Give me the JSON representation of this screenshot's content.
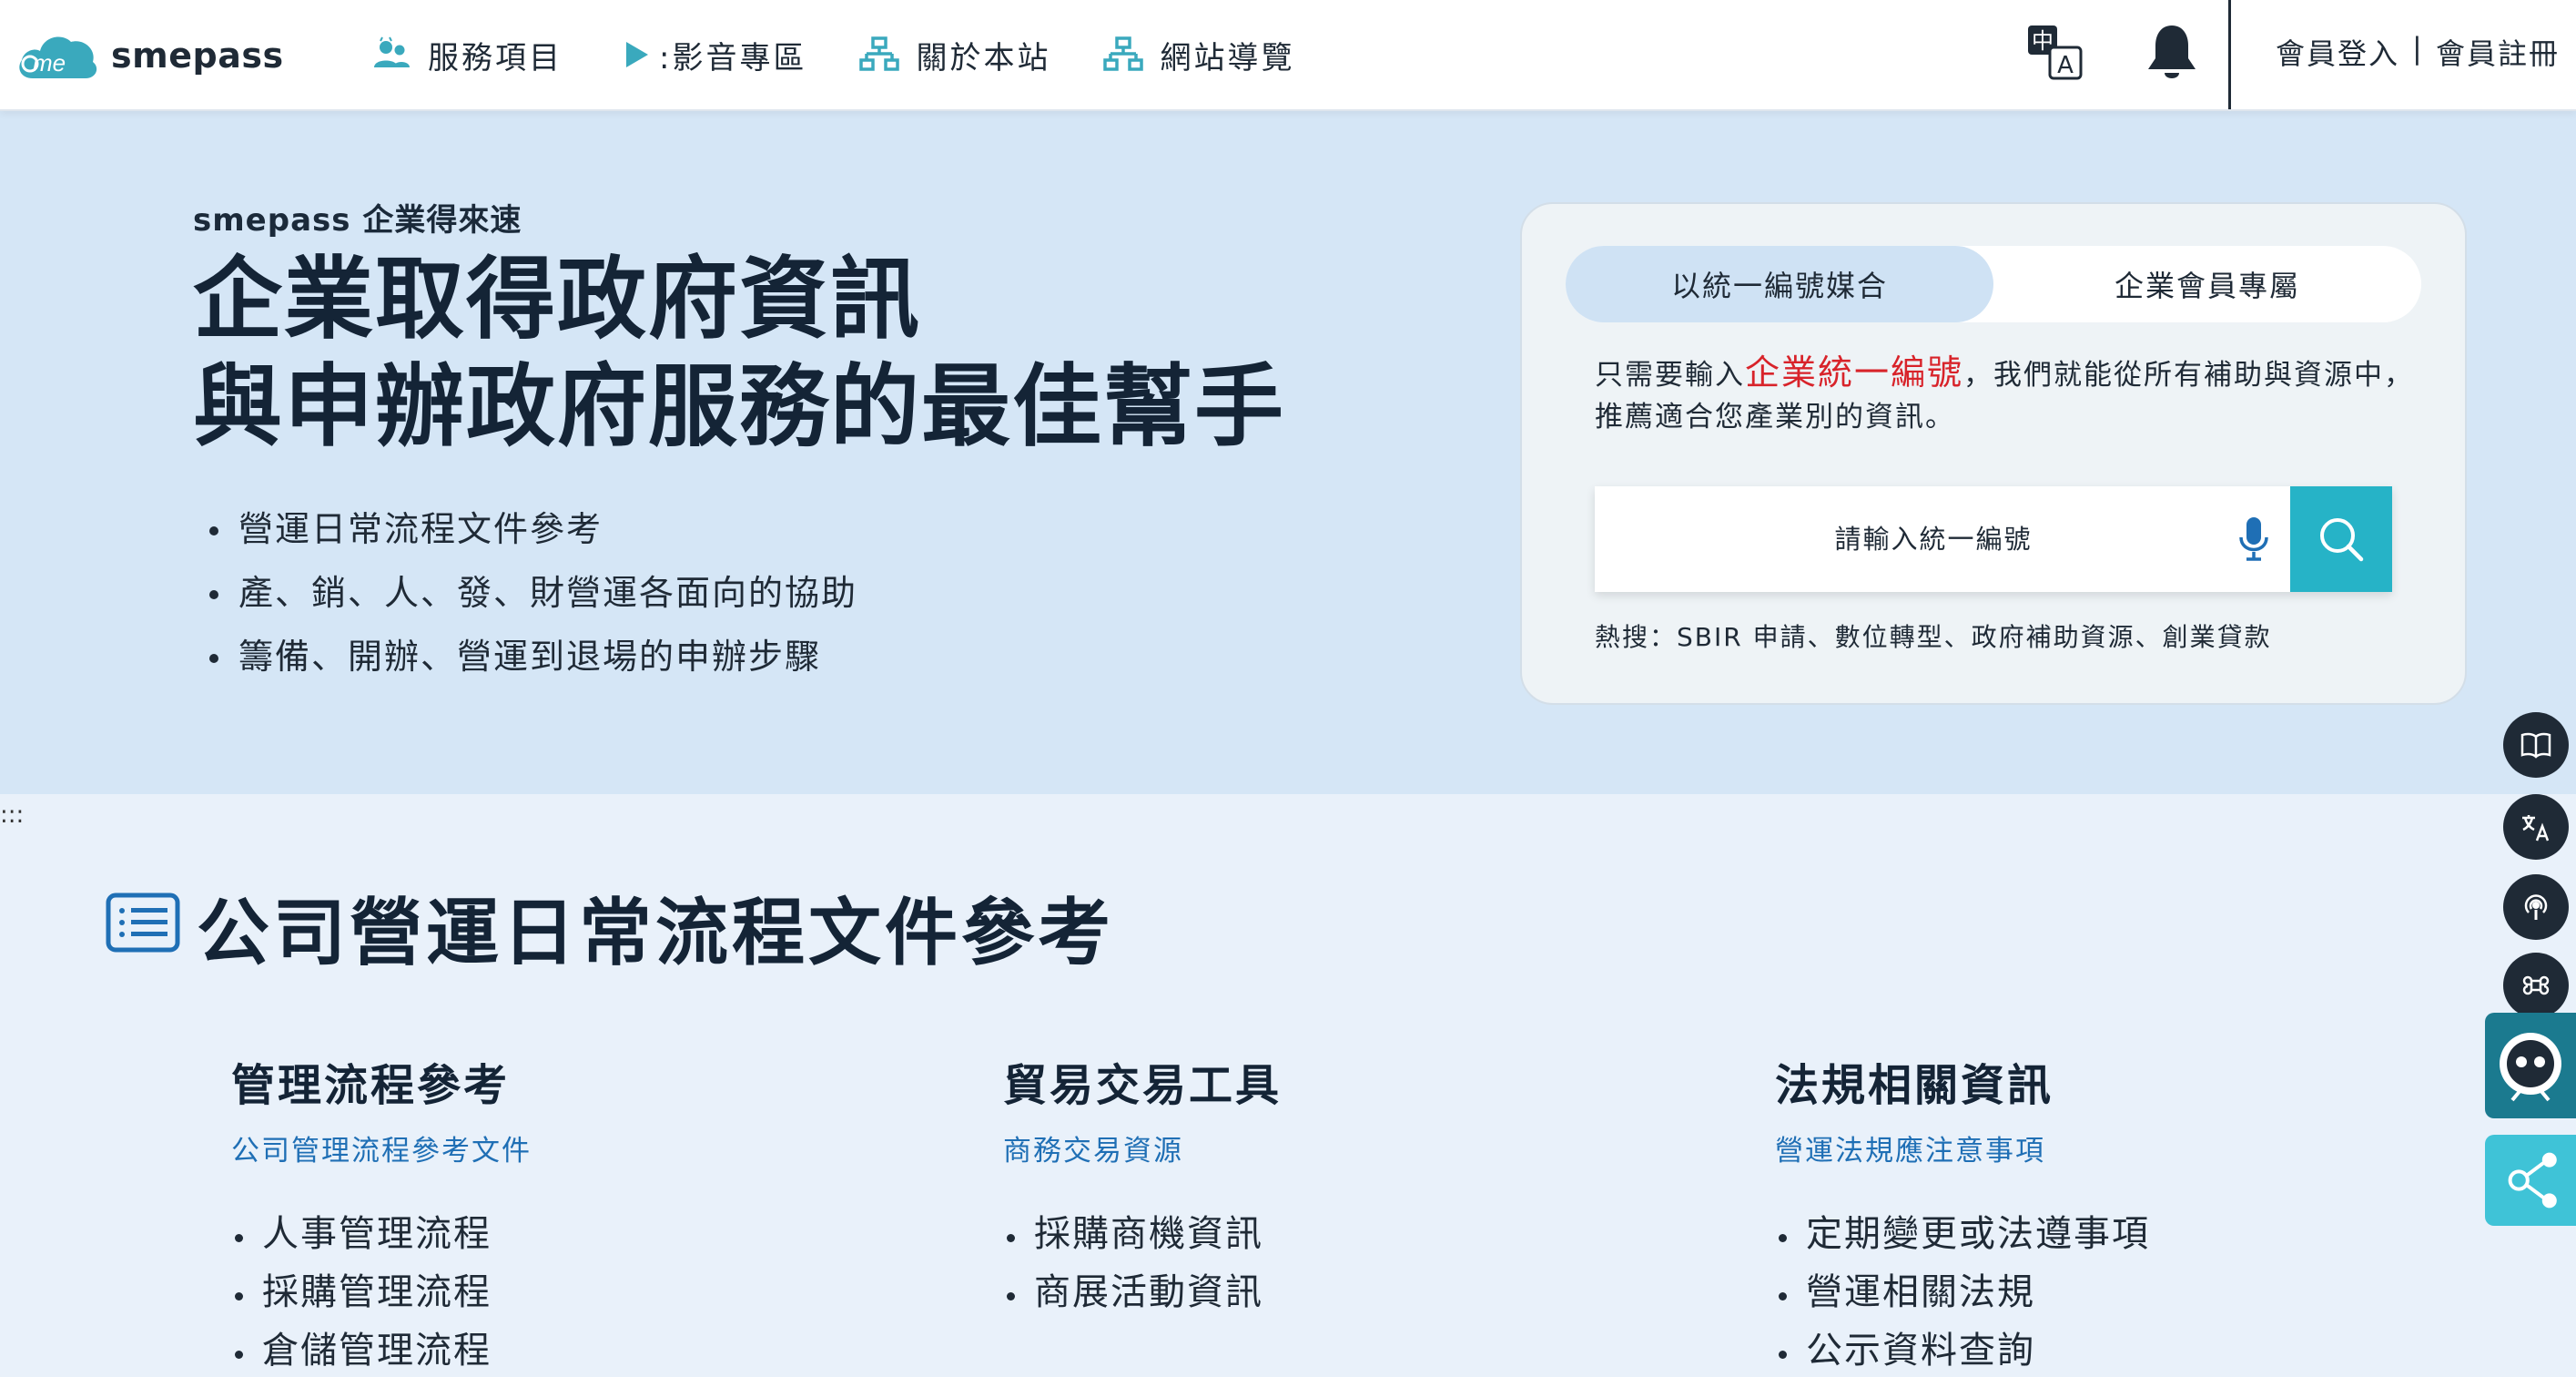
{
  "header": {
    "logo_text": "smepass",
    "nav": [
      {
        "label": "服務項目",
        "icon": "users-icon"
      },
      {
        "label": ":影音專區",
        "icon": "play-icon"
      },
      {
        "label": "關於本站",
        "icon": "sitemap-icon"
      },
      {
        "label": "網站導覽",
        "icon": "sitemap-icon"
      }
    ],
    "login": "會員登入",
    "separator": "|",
    "register": "會員註冊",
    "translate_icon_glyphs": {
      "top": "中",
      "bottom": "A"
    }
  },
  "hero": {
    "tag": "smepass 企業得來速",
    "title_line1": "企業取得政府資訊",
    "title_line2": "與申辦政府服務的最佳幫手",
    "bullets": [
      "營運日常流程文件參考",
      "產、銷、人、發、財營運各面向的協助",
      "籌備、開辦、營運到退場的申辦步驟"
    ]
  },
  "search_card": {
    "tabs": [
      {
        "label": "以統一編號媒合",
        "active": true
      },
      {
        "label": "企業會員專屬",
        "active": false
      }
    ],
    "desc_prefix": "只需要輸入",
    "desc_highlight": "企業統一編號",
    "desc_suffix": "，我們就能從所有補助與資源中，推薦適合您產業別的資訊。",
    "placeholder": "請輸入統一編號",
    "hot_searches": "熱搜：SBIR 申請、數位轉型、政府補助資源、創業貸款"
  },
  "section": {
    "accesskey": ":::",
    "title": "公司營運日常流程文件參考",
    "columns": [
      {
        "title": "管理流程參考",
        "subtitle": "公司管理流程參考文件",
        "items": [
          "人事管理流程",
          "採購管理流程",
          "倉儲管理流程"
        ]
      },
      {
        "title": "貿易交易工具",
        "subtitle": "商務交易資源",
        "items": [
          "採購商機資訊",
          "商展活動資訊"
        ]
      },
      {
        "title": "法規相關資訊",
        "subtitle": "營運法規應注意事項",
        "items": [
          "定期變更或法遵事項",
          "營運相關法規",
          "公示資料查詢"
        ]
      }
    ]
  },
  "colors": {
    "accent": "#26b3c7",
    "hero_bg": "#d5e6f6",
    "highlight_red": "#d8232a",
    "link_blue": "#1f6fb5",
    "dark": "#142436"
  }
}
